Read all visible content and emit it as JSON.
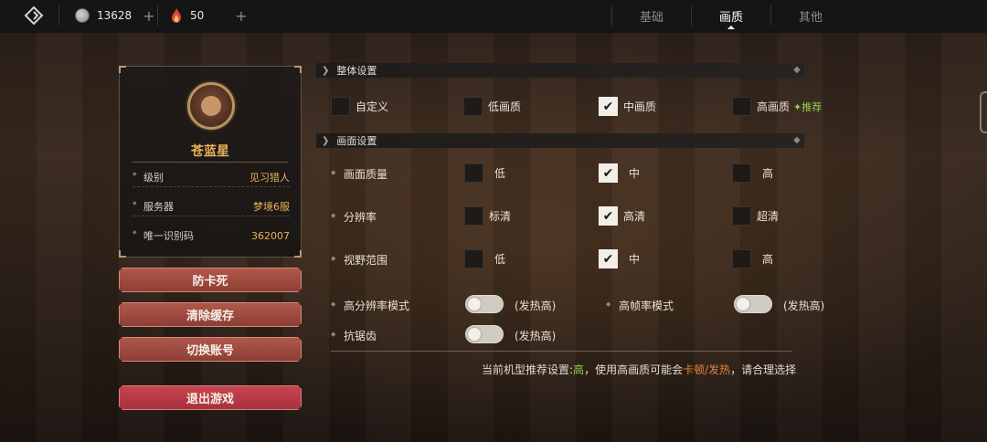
{
  "topbar": {
    "currency1": {
      "icon": "coin-icon",
      "value": "13628"
    },
    "currency2": {
      "icon": "flame-icon",
      "value": "50"
    },
    "plus": "+"
  },
  "tabs": [
    {
      "label": "基础",
      "active": false
    },
    {
      "label": "画质",
      "active": true
    },
    {
      "label": "其他",
      "active": false
    }
  ],
  "profile": {
    "name": "苍蓝星",
    "rows": [
      {
        "label": "级别",
        "value": "见习猎人"
      },
      {
        "label": "服务器",
        "value": "梦境6服"
      },
      {
        "label": "唯一识别码",
        "value": "362007"
      }
    ]
  },
  "buttons": {
    "anti_lag": "防卡死",
    "clear_cache": "清除缓存",
    "switch_account": "切换账号",
    "exit_game": "退出游戏"
  },
  "overall": {
    "title": "整体设置",
    "options": [
      {
        "label": "自定义",
        "checked": false
      },
      {
        "label": "低画质",
        "checked": false
      },
      {
        "label": "中画质",
        "checked": true
      },
      {
        "label": "高画质",
        "checked": false
      }
    ],
    "recommend": "推荐"
  },
  "screen": {
    "title": "画面设置",
    "rows": [
      {
        "label": "画面质量",
        "options": [
          {
            "label": "低",
            "checked": false
          },
          {
            "label": "中",
            "checked": true
          },
          {
            "label": "高",
            "checked": false
          }
        ]
      },
      {
        "label": "分辨率",
        "options": [
          {
            "label": "标清",
            "checked": false
          },
          {
            "label": "高清",
            "checked": true
          },
          {
            "label": "超清",
            "checked": false
          }
        ]
      },
      {
        "label": "视野范围",
        "options": [
          {
            "label": "低",
            "checked": false
          },
          {
            "label": "中",
            "checked": true
          },
          {
            "label": "高",
            "checked": false
          }
        ]
      }
    ],
    "toggles": {
      "high_res": {
        "label": "高分辨率模式",
        "note": "(发热高)",
        "on": false
      },
      "high_fps": {
        "label": "高帧率模式",
        "note": "(发热高)",
        "on": false
      },
      "anti_alias": {
        "label": "抗锯齿",
        "note": "(发热高)",
        "on": false
      }
    }
  },
  "hint": {
    "part1": "当前机型推荐设置:",
    "level": "高",
    "part2": "，使用高画质可能会",
    "warn": "卡顿/发热",
    "part3": "，请合理选择"
  },
  "colors": {
    "accent_gold": "#e6b35a",
    "button_red": "#a5323d",
    "recommend_green": "#8fd34a",
    "warn_orange": "#e3843f"
  }
}
